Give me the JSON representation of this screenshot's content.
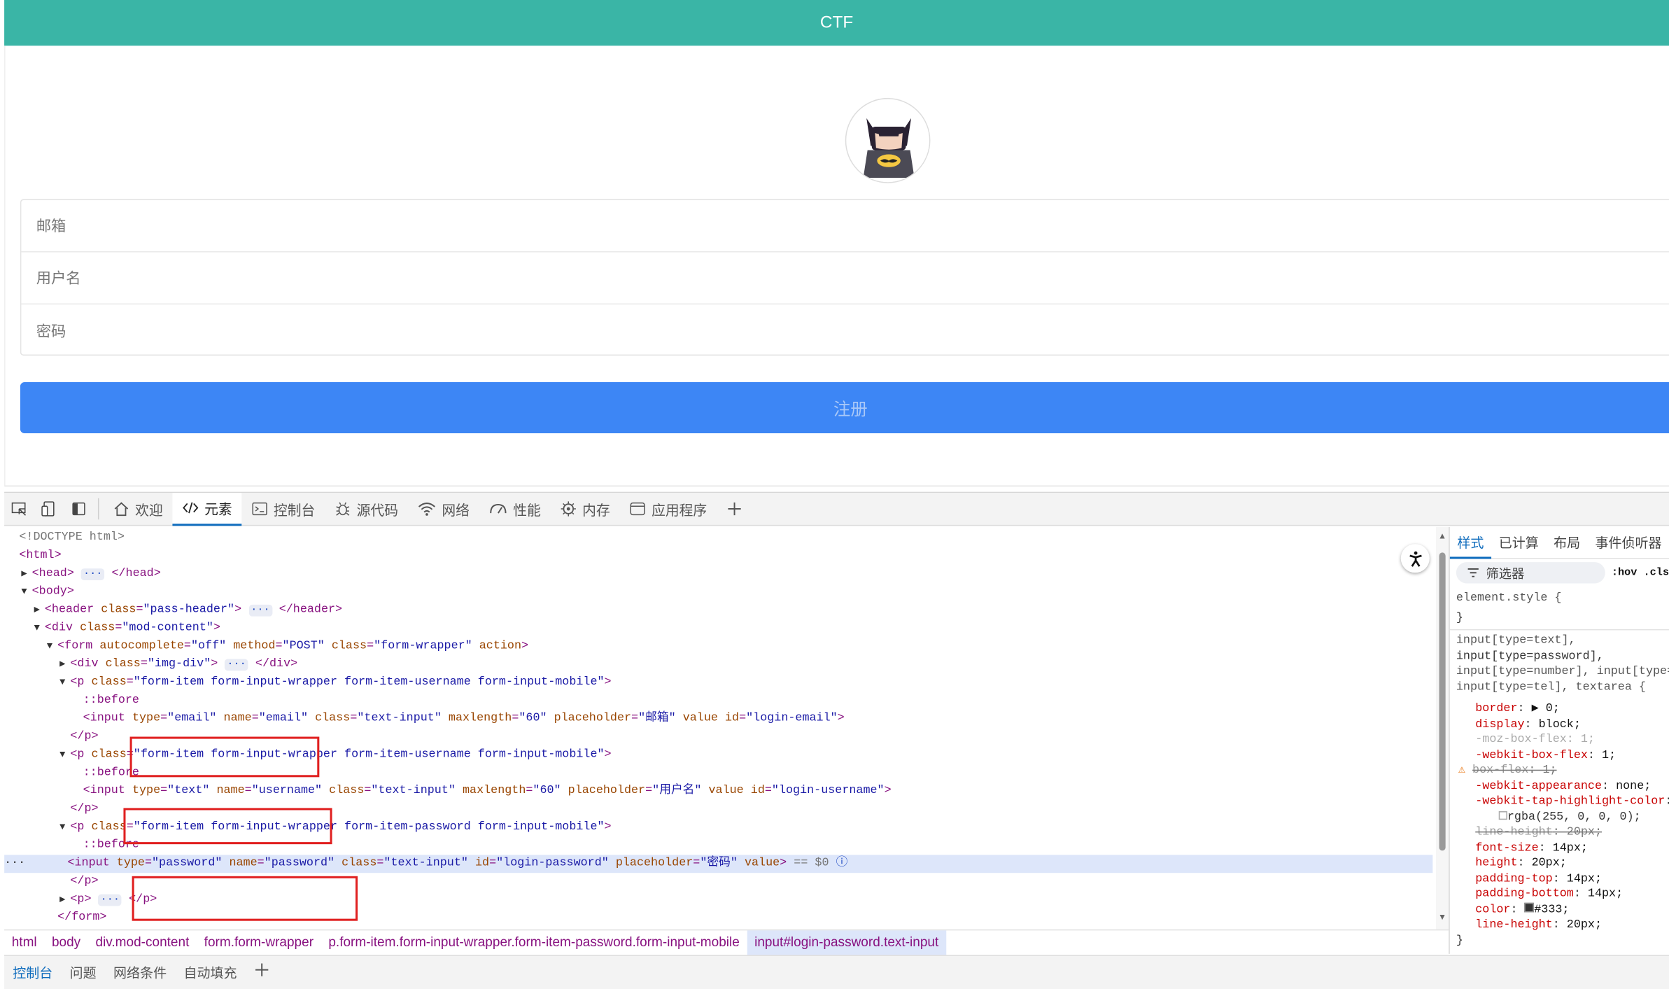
{
  "page": {
    "header_title": "CTF",
    "email_placeholder": "邮箱",
    "username_placeholder": "用户名",
    "password_placeholder": "密码",
    "submit_label": "注册"
  },
  "devtools": {
    "tabs": [
      {
        "label": "欢迎",
        "icon": "home-icon"
      },
      {
        "label": "元素",
        "icon": "code-icon"
      },
      {
        "label": "控制台",
        "icon": "console-icon"
      },
      {
        "label": "源代码",
        "icon": "bug-icon"
      },
      {
        "label": "网络",
        "icon": "wifi-icon"
      },
      {
        "label": "性能",
        "icon": "gauge-icon"
      },
      {
        "label": "内存",
        "icon": "chip-icon"
      },
      {
        "label": "应用程序",
        "icon": "app-icon"
      }
    ],
    "active_tab": "元素",
    "breadcrumbs": [
      "html",
      "body",
      "div.mod-content",
      "form.form-wrapper",
      "p.form-item.form-input-wrapper.form-item-password.form-input-mobile",
      "input#login-password.text-input"
    ],
    "styles_tabs": [
      "样式",
      "已计算",
      "布局",
      "事件侦听器"
    ],
    "filter_label": "筛选器",
    "hov_label": ":hov",
    "cls_label": ".cls",
    "drawer_tabs": [
      "控制台",
      "问题",
      "网络条件",
      "自动填充"
    ],
    "accent_color": "#0f6cbd",
    "header_color": "#3ab5a6",
    "button_color": "#3d86f5"
  }
}
